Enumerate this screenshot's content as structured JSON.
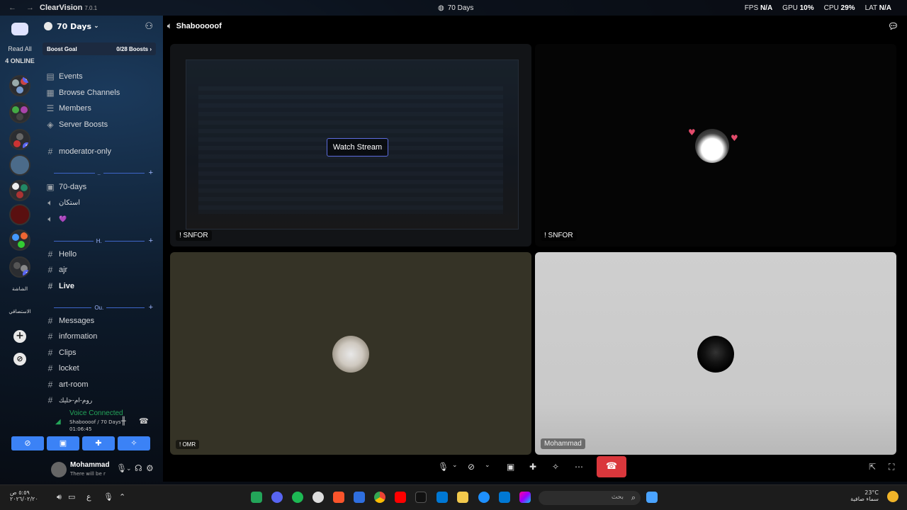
{
  "titlebar": {
    "app_name": "ClearVision",
    "version": "7.0.1",
    "window_title": "70 Days",
    "fps_label": "FPS",
    "fps_value": "N/A",
    "gpu_label": "GPU",
    "gpu_value": "10%",
    "cpu_label": "CPU",
    "cpu_value": "29%",
    "lat_label": "LAT",
    "lat_value": "N/A"
  },
  "rail": {
    "read_all": "Read All",
    "online": "4 ONLINE",
    "badges": [
      "6",
      "5",
      "6",
      "1"
    ]
  },
  "sidebar": {
    "server_name": "70 Days",
    "boost_goal": "Boost Goal",
    "boost_count": "0/28 Boosts",
    "top_items": [
      "Events",
      "Browse Channels",
      "Members",
      "Server Boosts"
    ],
    "moderator": "moderator-only",
    "cat1": "..",
    "cat1_items": [
      "70-days",
      "استكان",
      "💜"
    ],
    "cat2": "H.",
    "cat2_items": [
      "Hello",
      "ajr",
      "Live"
    ],
    "cat3": "Ou.",
    "cat3_items": [
      "Messages",
      "information",
      "Clips",
      "locket",
      "art-room",
      "روم-ام-حليك"
    ]
  },
  "voice": {
    "status": "Voice Connected",
    "channel": "Shaboooof / 70 Days",
    "timer": "01:06:45"
  },
  "user": {
    "name": "Mohammad",
    "status": "There will be r"
  },
  "main": {
    "channel_name": "Shabooooof",
    "watch_stream": "Watch Stream",
    "tiles": {
      "stream_name": "! SNFOR",
      "top_right_name": "! SNFOR",
      "omr_name": "! OMR",
      "mohammad_name": "Mohammad"
    }
  },
  "taskbar": {
    "time": "٥:٥٩ ص",
    "date": "٢٠٢٦/٠٢/٢٠",
    "lang": "ع",
    "search_placeholder": "بحث",
    "temp": "23°C",
    "weather": "سماء صافية"
  },
  "colors": {
    "accent": "#5865f2",
    "voice_green": "#23a559",
    "hangup_red": "#da373c",
    "button_blue": "#3b82f6"
  }
}
